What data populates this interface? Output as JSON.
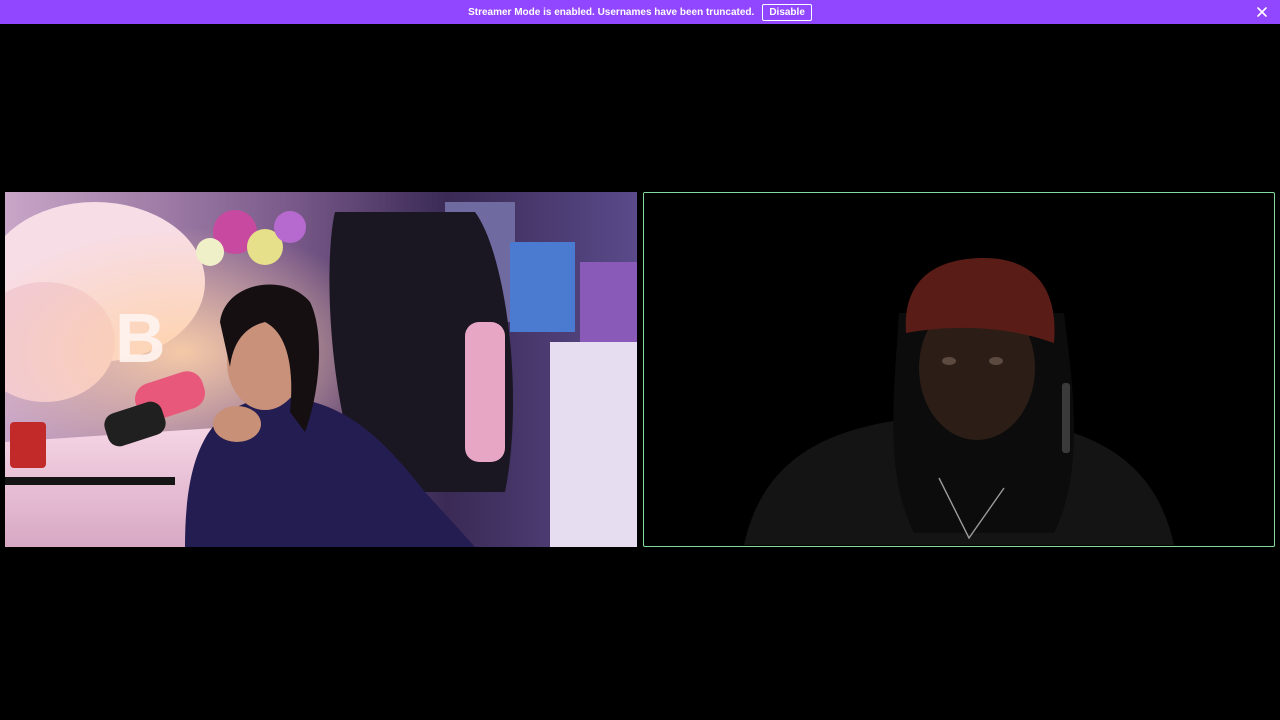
{
  "banner": {
    "message": "Streamer Mode is enabled. Usernames have been truncated.",
    "disable_label": "Disable",
    "close_icon": "close-icon",
    "background_color": "#9146ff"
  },
  "tiles": [
    {
      "role": "participant-video-1",
      "active_speaker": false
    },
    {
      "role": "participant-video-2",
      "active_speaker": true,
      "highlight_color": "#7fdc9a"
    }
  ]
}
